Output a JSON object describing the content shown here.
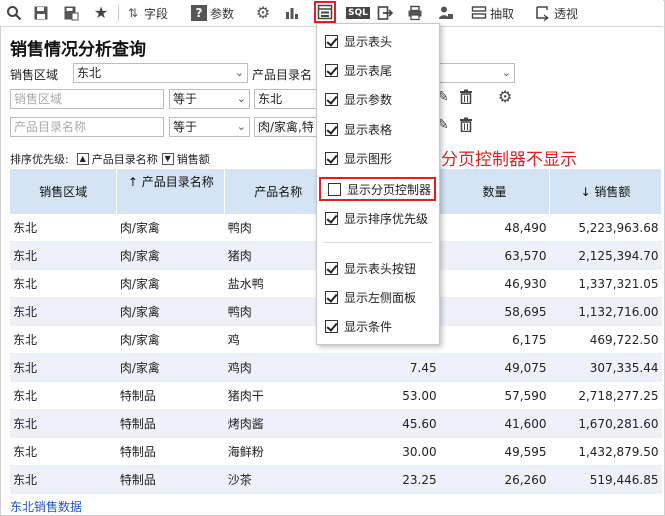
{
  "toolbar": {
    "field_label": "字段",
    "param_label": "参数",
    "extract_label": "抽取",
    "pivot_label": "透视",
    "sql_label": "SQL"
  },
  "page": {
    "title": "销售情况分析查询",
    "footer_link": "东北销售数据"
  },
  "filters": {
    "region_label": "销售区域",
    "region_value": "东北",
    "category_label": "产品目录名",
    "row1": {
      "field_placeholder": "销售区域",
      "operator": "等于",
      "value": "东北"
    },
    "row2": {
      "field_placeholder": "产品目录名称",
      "operator": "等于",
      "value": "肉/家禽,特"
    }
  },
  "sort": {
    "label": "排序优先级:",
    "chip1": "产品目录名称",
    "chip2": "销售额"
  },
  "table": {
    "headers": [
      "销售区域",
      "↑ 产品目录名称",
      "产品名称",
      "",
      "数量",
      "↓ 销售额"
    ],
    "rows": [
      [
        "东北",
        "肉/家禽",
        "鸭肉",
        "",
        "48,490",
        "5,223,963.68"
      ],
      [
        "东北",
        "肉/家禽",
        "猪肉",
        "",
        "63,570",
        "2,125,394.70"
      ],
      [
        "东北",
        "肉/家禽",
        "盐水鸭",
        "",
        "46,930",
        "1,337,321.05"
      ],
      [
        "东北",
        "肉/家禽",
        "鸭肉",
        "",
        "58,695",
        "1,132,716.00"
      ],
      [
        "东北",
        "肉/家禽",
        "鸡",
        "",
        "6,175",
        "469,722.50"
      ],
      [
        "东北",
        "肉/家禽",
        "鸡肉",
        "7.45",
        "49,075",
        "307,335.44"
      ],
      [
        "东北",
        "特制品",
        "猪肉干",
        "53.00",
        "57,590",
        "2,718,277.25"
      ],
      [
        "东北",
        "特制品",
        "烤肉酱",
        "45.60",
        "41,600",
        "1,670,281.60"
      ],
      [
        "东北",
        "特制品",
        "海鲜粉",
        "30.00",
        "49,595",
        "1,432,879.50"
      ],
      [
        "东北",
        "特制品",
        "沙茶",
        "23.25",
        "26,260",
        "519,446.85"
      ]
    ]
  },
  "menu": {
    "items": [
      {
        "label": "显示表头",
        "checked": true
      },
      {
        "label": "显示表尾",
        "checked": true
      },
      {
        "label": "显示参数",
        "checked": true
      },
      {
        "label": "显示表格",
        "checked": true
      },
      {
        "label": "显示图形",
        "checked": true
      },
      {
        "label": "显示分页控制器",
        "checked": false
      },
      {
        "label": "显示排序优先级",
        "checked": true
      },
      {
        "label": "显示表头按钮",
        "checked": true
      },
      {
        "label": "显示左侧面板",
        "checked": true
      },
      {
        "label": "显示条件",
        "checked": true
      }
    ]
  },
  "annotation": "分页控制器不显示",
  "colors": {
    "accent_red": "#e02020",
    "header_blue": "#d4e4f5",
    "row_alt": "#eef0fa",
    "link_blue": "#2255cc"
  }
}
